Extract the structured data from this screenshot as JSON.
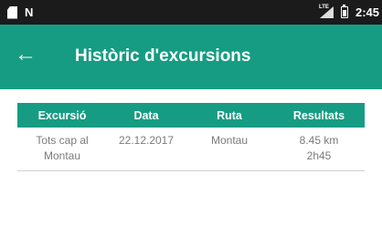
{
  "status_bar": {
    "left_icons": [
      "sim-card-icon",
      "nfc-n-icon"
    ],
    "n_glyph": "N",
    "signal_badge": "LTE",
    "time": "2:45"
  },
  "app_bar": {
    "back_icon": "arrow-back-icon",
    "back_glyph": "←",
    "title": "Històric d'excursions",
    "color": "#169c82"
  },
  "table": {
    "headers": [
      "Excursió",
      "Data",
      "Ruta",
      "Resultats"
    ],
    "rows": [
      {
        "excursio": [
          "Tots cap al",
          "Montau"
        ],
        "data": "22.12.2017",
        "ruta": "Montau",
        "resultats": [
          "8.45 km",
          "2h45"
        ]
      }
    ]
  }
}
